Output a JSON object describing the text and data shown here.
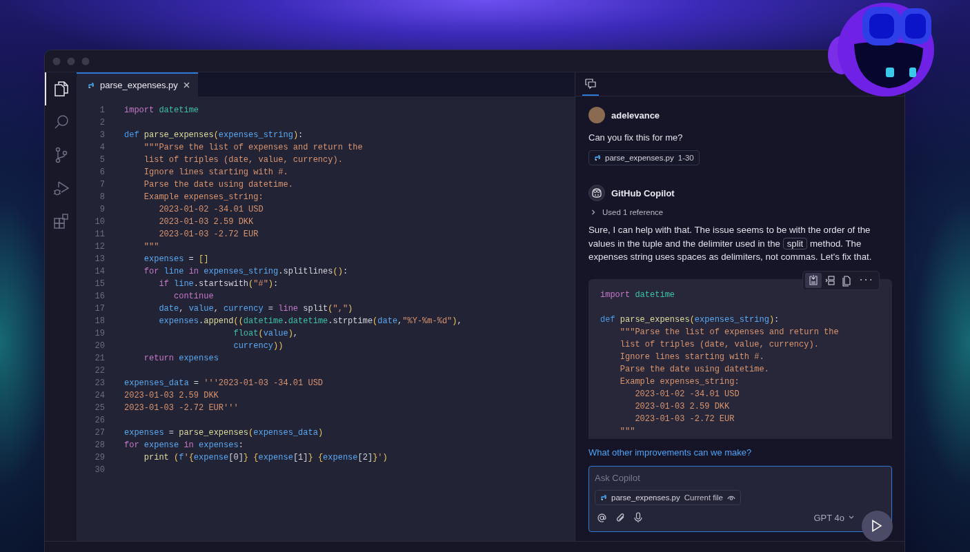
{
  "activity_bar": {
    "items": [
      {
        "selected": true
      },
      {
        "selected": false
      },
      {
        "selected": false
      },
      {
        "selected": false
      },
      {
        "selected": false
      }
    ]
  },
  "editor": {
    "tabs": [
      {
        "label": "parse_expenses.py",
        "selected": true
      }
    ],
    "lines": [
      {
        "number": "1",
        "tokens": [
          {
            "kind": "kw",
            "text": "import "
          },
          {
            "kind": "mod",
            "text": "datetime"
          }
        ]
      },
      {
        "number": "2"
      },
      {
        "number": "3",
        "tokens": [
          {
            "kind": "def",
            "text": "def "
          },
          {
            "kind": "fn",
            "text": "parse_expenses"
          },
          {
            "kind": "br",
            "text": "("
          },
          {
            "kind": "var",
            "text": "expenses_string"
          },
          {
            "kind": "br",
            "text": ")"
          },
          {
            "kind": "p",
            "text": ":"
          }
        ]
      },
      {
        "number": "4",
        "tokens": [
          {
            "kind": "str",
            "text": "    \"\"\"Parse the list of expenses and return the"
          }
        ]
      },
      {
        "number": "5",
        "tokens": [
          {
            "kind": "str",
            "text": "    list of triples (date, value, currency)."
          }
        ]
      },
      {
        "number": "6",
        "tokens": [
          {
            "kind": "str",
            "text": "    Ignore lines starting with #."
          }
        ]
      },
      {
        "number": "7",
        "tokens": [
          {
            "kind": "str",
            "text": "    Parse the date using datetime."
          }
        ]
      },
      {
        "number": "8",
        "tokens": [
          {
            "kind": "str",
            "text": "    Example expenses_string:"
          }
        ]
      },
      {
        "number": "9",
        "tokens": [
          {
            "kind": "str",
            "text": "       2023-01-02 -34.01 USD"
          }
        ]
      },
      {
        "number": "10",
        "tokens": [
          {
            "kind": "str",
            "text": "       2023-01-03 2.59 DKK"
          }
        ]
      },
      {
        "number": "11",
        "tokens": [
          {
            "kind": "str",
            "text": "       2023-01-03 -2.72 EUR"
          }
        ]
      },
      {
        "number": "12",
        "tokens": [
          {
            "kind": "str",
            "text": "    \"\"\""
          }
        ]
      },
      {
        "number": "13",
        "tokens": [
          {
            "kind": "var",
            "text": "    expenses"
          },
          {
            "kind": "p",
            "text": " = "
          },
          {
            "kind": "br",
            "text": "[]"
          }
        ]
      },
      {
        "number": "14",
        "tokens": [
          {
            "kind": "kw",
            "text": "    for "
          },
          {
            "kind": "var",
            "text": "line "
          },
          {
            "kind": "kw",
            "text": "in "
          },
          {
            "kind": "var",
            "text": "expenses_string"
          },
          {
            "kind": "p",
            "text": ".splitlines"
          },
          {
            "kind": "br",
            "text": "()"
          },
          {
            "kind": "p",
            "text": ":"
          }
        ]
      },
      {
        "number": "15",
        "tokens": [
          {
            "kind": "kw",
            "text": "       if "
          },
          {
            "kind": "var",
            "text": "line"
          },
          {
            "kind": "p",
            "text": ".startswith"
          },
          {
            "kind": "br",
            "text": "("
          },
          {
            "kind": "str",
            "text": "\"#\""
          },
          {
            "kind": "br",
            "text": ")"
          },
          {
            "kind": "p",
            "text": ":"
          }
        ]
      },
      {
        "number": "16",
        "tokens": [
          {
            "kind": "kw",
            "text": "          continue"
          }
        ]
      },
      {
        "number": "17",
        "tokens": [
          {
            "kind": "var",
            "text": "       date"
          },
          {
            "kind": "p",
            "text": ", "
          },
          {
            "kind": "var",
            "text": "value"
          },
          {
            "kind": "p",
            "text": ", "
          },
          {
            "kind": "var",
            "text": "currency"
          },
          {
            "kind": "p",
            "text": " = "
          },
          {
            "kind": "kw",
            "text": "line "
          },
          {
            "kind": "p",
            "text": "split"
          },
          {
            "kind": "br",
            "text": "("
          },
          {
            "kind": "str",
            "text": "\",\""
          },
          {
            "kind": "br",
            "text": ")"
          }
        ]
      },
      {
        "number": "18",
        "tokens": [
          {
            "kind": "var",
            "text": "       expenses"
          },
          {
            "kind": "p",
            "text": "."
          },
          {
            "kind": "fn",
            "text": "append"
          },
          {
            "kind": "br",
            "text": "(("
          },
          {
            "kind": "mod",
            "text": "datetime"
          },
          {
            "kind": "p",
            "text": "."
          },
          {
            "kind": "mod",
            "text": "datetime"
          },
          {
            "kind": "p",
            "text": ".strptime"
          },
          {
            "kind": "br",
            "text": "("
          },
          {
            "kind": "var",
            "text": "date"
          },
          {
            "kind": "p",
            "text": ","
          },
          {
            "kind": "str",
            "text": "\"%Y-%m-%d\""
          },
          {
            "kind": "br",
            "text": ")"
          },
          {
            "kind": "p",
            "text": ","
          }
        ]
      },
      {
        "number": "19",
        "tokens": [
          {
            "kind": "mod",
            "text": "                      float"
          },
          {
            "kind": "br",
            "text": "("
          },
          {
            "kind": "var",
            "text": "value"
          },
          {
            "kind": "br",
            "text": ")"
          },
          {
            "kind": "p",
            "text": ","
          }
        ]
      },
      {
        "number": "20",
        "tokens": [
          {
            "kind": "var",
            "text": "                      currency"
          },
          {
            "kind": "br",
            "text": "))"
          }
        ]
      },
      {
        "number": "21",
        "tokens": [
          {
            "kind": "kw",
            "text": "    return "
          },
          {
            "kind": "var",
            "text": "expenses"
          }
        ]
      },
      {
        "number": "22"
      },
      {
        "number": "23",
        "tokens": [
          {
            "kind": "var",
            "text": "expenses_data"
          },
          {
            "kind": "p",
            "text": " = "
          },
          {
            "kind": "str",
            "text": "'''2023-01-03 -34.01 USD"
          }
        ]
      },
      {
        "number": "24",
        "tokens": [
          {
            "kind": "str",
            "text": "2023-01-03 2.59 DKK"
          }
        ]
      },
      {
        "number": "25",
        "tokens": [
          {
            "kind": "str",
            "text": "2023-01-03 -2.72 EUR'''"
          }
        ]
      },
      {
        "number": "26"
      },
      {
        "number": "27",
        "tokens": [
          {
            "kind": "var",
            "text": "expenses"
          },
          {
            "kind": "p",
            "text": " = "
          },
          {
            "kind": "fn",
            "text": "parse_expenses"
          },
          {
            "kind": "br",
            "text": "("
          },
          {
            "kind": "var",
            "text": "expenses_data"
          },
          {
            "kind": "br",
            "text": ")"
          }
        ]
      },
      {
        "number": "28",
        "tokens": [
          {
            "kind": "kw",
            "text": "for "
          },
          {
            "kind": "var",
            "text": "expense "
          },
          {
            "kind": "kw",
            "text": "in "
          },
          {
            "kind": "var",
            "text": "expenses"
          },
          {
            "kind": "p",
            "text": ":"
          }
        ]
      },
      {
        "number": "29",
        "tokens": [
          {
            "kind": "fn",
            "text": "    print "
          },
          {
            "kind": "br",
            "text": "("
          },
          {
            "kind": "var",
            "text": "f"
          },
          {
            "kind": "str",
            "text": "'"
          },
          {
            "kind": "br",
            "text": "{"
          },
          {
            "kind": "var",
            "text": "expense"
          },
          {
            "kind": "p",
            "text": "[0]"
          },
          {
            "kind": "br",
            "text": "} {"
          },
          {
            "kind": "var",
            "text": "expense"
          },
          {
            "kind": "p",
            "text": "[1]"
          },
          {
            "kind": "br",
            "text": "} {"
          },
          {
            "kind": "var",
            "text": "expense"
          },
          {
            "kind": "p",
            "text": "[2]"
          },
          {
            "kind": "br",
            "text": "}"
          },
          {
            "kind": "str",
            "text": "'"
          },
          {
            "kind": "br",
            "text": ")"
          }
        ]
      },
      {
        "number": "30"
      }
    ]
  },
  "chat": {
    "header_tabs": [
      {
        "selected": true
      }
    ],
    "user_message": {
      "author": "adelevance",
      "text": "Can you fix this for me?",
      "reference": {
        "file": "parse_expenses.py",
        "range": "1-30"
      }
    },
    "assistant_message": {
      "author": "GitHub Copilot",
      "references_toggle": {
        "label": "Used 1 reference",
        "expanded": false
      },
      "response": {
        "before": "Sure, I can help with that. The issue seems to be with the order of the values in the tuple and the delimiter used in the",
        "code": "split",
        "after": "method. The expenses string uses spaces as delimiters, not commas. Let's fix that."
      },
      "code_toolbar": {
        "more": "···"
      },
      "code_groups": [
        {
          "lines": [
            {
              "tokens": [
                {
                  "kind": "kw",
                  "text": "import "
                },
                {
                  "kind": "mod",
                  "text": "datetime"
                }
              ]
            }
          ]
        },
        {
          "lines": [
            {
              "tokens": [
                {
                  "kind": "def",
                  "text": "def "
                },
                {
                  "kind": "fn",
                  "text": "parse_expenses"
                },
                {
                  "kind": "br",
                  "text": "("
                },
                {
                  "kind": "var",
                  "text": "expenses_string"
                },
                {
                  "kind": "br",
                  "text": ")"
                },
                {
                  "kind": "p",
                  "text": ":"
                }
              ]
            },
            {
              "tokens": [
                {
                  "kind": "str",
                  "text": "    \"\"\"Parse the list of expenses and return the"
                }
              ]
            },
            {
              "tokens": [
                {
                  "kind": "str",
                  "text": "    list of triples (date, value, currency)."
                }
              ]
            },
            {
              "tokens": [
                {
                  "kind": "str",
                  "text": "    Ignore lines starting with #."
                }
              ]
            },
            {
              "tokens": [
                {
                  "kind": "str",
                  "text": "    Parse the date using datetime."
                }
              ]
            },
            {
              "tokens": [
                {
                  "kind": "str",
                  "text": "    Example expenses_string:"
                }
              ]
            },
            {
              "tokens": [
                {
                  "kind": "str",
                  "text": "       2023-01-02 -34.01 USD"
                }
              ]
            },
            {
              "tokens": [
                {
                  "kind": "str",
                  "text": "       2023-01-03 2.59 DKK"
                }
              ]
            },
            {
              "tokens": [
                {
                  "kind": "str",
                  "text": "       2023-01-03 -2.72 EUR"
                }
              ]
            },
            {
              "tokens": [
                {
                  "kind": "str",
                  "text": "    \"\"\""
                }
              ]
            }
          ]
        }
      ]
    },
    "suggestion": "What other improvements can we make?",
    "input": {
      "placeholder": "Ask Copilot",
      "attachment": {
        "file": "parse_expenses.py",
        "label": "Current file"
      },
      "model": "GPT 4o"
    }
  }
}
